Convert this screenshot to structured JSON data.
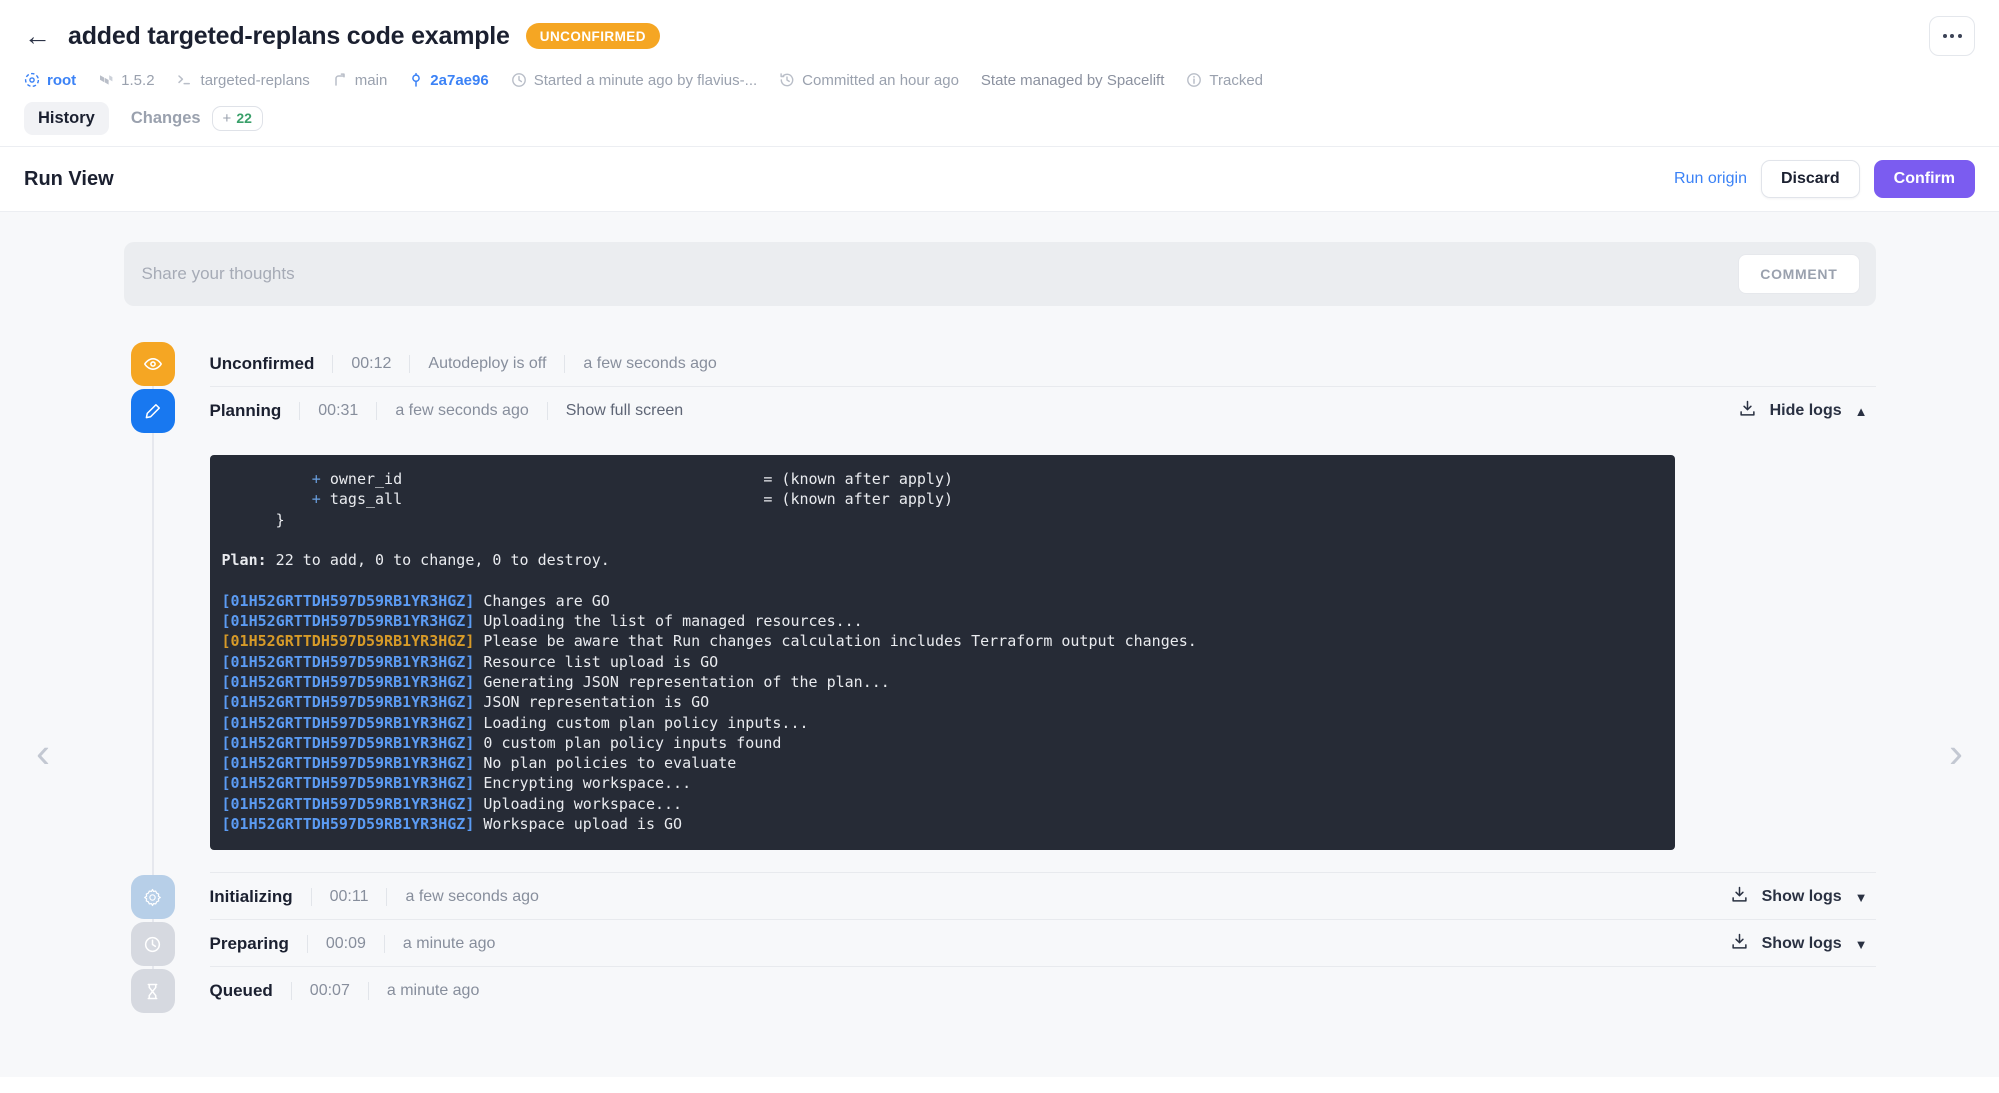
{
  "header": {
    "back_icon": "arrow-left-icon",
    "title": "added targeted-replans code example",
    "status": "UNCONFIRMED",
    "overflow_icon": "ellipsis-icon",
    "meta": [
      {
        "icon": "space-icon",
        "text": "root",
        "style": "link"
      },
      {
        "icon": "terraform-icon",
        "text": "1.5.2",
        "style": "dim"
      },
      {
        "icon": "stack-icon",
        "text": "targeted-replans",
        "style": "dim"
      },
      {
        "icon": "branch-icon",
        "text": "main",
        "style": "dim"
      },
      {
        "icon": "commit-icon",
        "text": "2a7ae96",
        "style": "link"
      },
      {
        "icon": "clock-icon",
        "text": "Started a minute ago by flavius-...",
        "style": "dim"
      },
      {
        "icon": "history-icon",
        "text": "Committed an hour ago",
        "style": "dim"
      },
      {
        "icon": "none",
        "text": "State managed by Spacelift",
        "style": "dim"
      },
      {
        "icon": "info-icon",
        "text": "Tracked",
        "style": "dim"
      }
    ],
    "tabs": [
      {
        "label": "History",
        "active": true,
        "badge": null
      },
      {
        "label": "Changes",
        "active": false,
        "badge": {
          "plus": "+",
          "count": "22"
        }
      }
    ]
  },
  "runview": {
    "title": "Run View",
    "run_origin_label": "Run origin",
    "discard_label": "Discard",
    "confirm_label": "Confirm"
  },
  "comment": {
    "placeholder": "Share your thoughts",
    "submit_label": "COMMENT"
  },
  "nav": {
    "prev_icon": "chevron-left-icon",
    "next_icon": "chevron-right-icon"
  },
  "timeline": [
    {
      "name": "Unconfirmed",
      "icon": "eye-icon",
      "icon_color": "#f5a623",
      "duration": "00:12",
      "detail": "Autodeploy is off",
      "relative_time": "a few seconds ago",
      "action": null,
      "logs_toggle": null
    },
    {
      "name": "Planning",
      "icon": "pencil-icon",
      "icon_color": "#1878f0",
      "duration": "00:31",
      "detail": null,
      "relative_time": "a few seconds ago",
      "action": "Show full screen",
      "logs_toggle": "Hide logs",
      "logs_chevron": "chevron-up-icon",
      "download_icon": "download-icon"
    },
    {
      "name": "Initializing",
      "icon": "gear-icon",
      "icon_color": "#b7cfe8",
      "duration": "00:11",
      "detail": null,
      "relative_time": "a few seconds ago",
      "action": null,
      "logs_toggle": "Show logs",
      "logs_chevron": "chevron-down-icon",
      "download_icon": "download-icon"
    },
    {
      "name": "Preparing",
      "icon": "clock-icon",
      "icon_color": "#d6d9e0",
      "duration": "00:09",
      "detail": null,
      "relative_time": "a minute ago",
      "action": null,
      "logs_toggle": "Show logs",
      "logs_chevron": "chevron-down-icon",
      "download_icon": "download-icon"
    },
    {
      "name": "Queued",
      "icon": "hourglass-icon",
      "icon_color": "#d6d9e0",
      "duration": "00:07",
      "detail": null,
      "relative_time": "a minute ago",
      "action": null,
      "logs_toggle": null
    }
  ],
  "terminal": {
    "timestamp": "01H52GRTTDH597D59RB1YR3HGZ",
    "plan_lines": [
      {
        "indent": 10,
        "plus": "+",
        "key": "owner_id",
        "value": "= (known after apply)"
      },
      {
        "indent": 10,
        "plus": "+",
        "key": "tags_all",
        "value": "= (known after apply)"
      }
    ],
    "brace": "    }",
    "plan_summary_label": "Plan:",
    "plan_summary_text": " 22 to add, 0 to change, 0 to destroy.",
    "log_lines": [
      {
        "ts": "[01H52GRTTDH597D59RB1YR3HGZ]",
        "msg": "Changes are GO",
        "warn": false
      },
      {
        "ts": "[01H52GRTTDH597D59RB1YR3HGZ]",
        "msg": "Uploading the list of managed resources...",
        "warn": false
      },
      {
        "ts": "[01H52GRTTDH597D59RB1YR3HGZ]",
        "msg": "Please be aware that Run changes calculation includes Terraform output changes.",
        "warn": true
      },
      {
        "ts": "[01H52GRTTDH597D59RB1YR3HGZ]",
        "msg": "Resource list upload is GO",
        "warn": false
      },
      {
        "ts": "[01H52GRTTDH597D59RB1YR3HGZ]",
        "msg": "Generating JSON representation of the plan...",
        "warn": false
      },
      {
        "ts": "[01H52GRTTDH597D59RB1YR3HGZ]",
        "msg": "JSON representation is GO",
        "warn": false
      },
      {
        "ts": "[01H52GRTTDH597D59RB1YR3HGZ]",
        "msg": "Loading custom plan policy inputs...",
        "warn": false
      },
      {
        "ts": "[01H52GRTTDH597D59RB1YR3HGZ]",
        "msg": "0 custom plan policy inputs found",
        "warn": false
      },
      {
        "ts": "[01H52GRTTDH597D59RB1YR3HGZ]",
        "msg": "No plan policies to evaluate",
        "warn": false
      },
      {
        "ts": "[01H52GRTTDH597D59RB1YR3HGZ]",
        "msg": "Encrypting workspace...",
        "warn": false
      },
      {
        "ts": "[01H52GRTTDH597D59RB1YR3HGZ]",
        "msg": "Uploading workspace...",
        "warn": false
      },
      {
        "ts": "[01H52GRTTDH597D59RB1YR3HGZ]",
        "msg": "Workspace upload is GO",
        "warn": false
      }
    ]
  },
  "colors": {
    "accent_purple": "#7b5cf0",
    "link_blue": "#3b82f6",
    "status_amber": "#f5a623",
    "planning_blue": "#1878f0",
    "terminal_bg": "#262b36",
    "terminal_ts": "#5b9bf3",
    "terminal_warn": "#d79a28",
    "badge_green": "#3aa06a"
  }
}
